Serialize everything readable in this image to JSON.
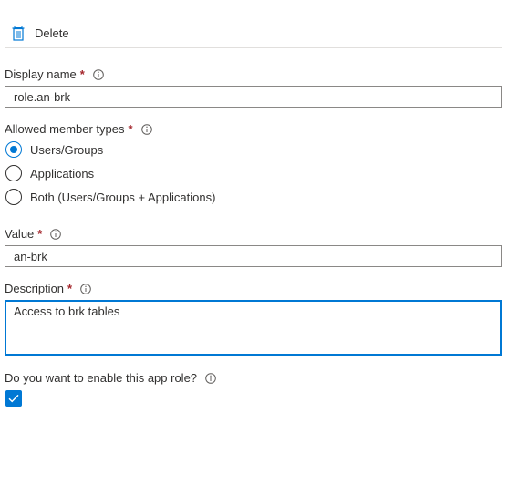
{
  "toolbar": {
    "delete_label": "Delete",
    "delete_icon": "trash-icon"
  },
  "colors": {
    "accent": "#0078d4",
    "required": "#a4262c",
    "border": "#8a8886"
  },
  "form": {
    "display_name": {
      "label": "Display name",
      "required_marker": "*",
      "value": "role.an-brk"
    },
    "allowed_member_types": {
      "label": "Allowed member types",
      "required_marker": "*",
      "options": [
        {
          "label": "Users/Groups",
          "selected": true
        },
        {
          "label": "Applications",
          "selected": false
        },
        {
          "label": "Both (Users/Groups + Applications)",
          "selected": false
        }
      ]
    },
    "value": {
      "label": "Value",
      "required_marker": "*",
      "value": "an-brk"
    },
    "description": {
      "label": "Description",
      "required_marker": "*",
      "value": "Access to brk tables"
    },
    "enable": {
      "label": "Do you want to enable this app role?",
      "checked": true
    }
  }
}
